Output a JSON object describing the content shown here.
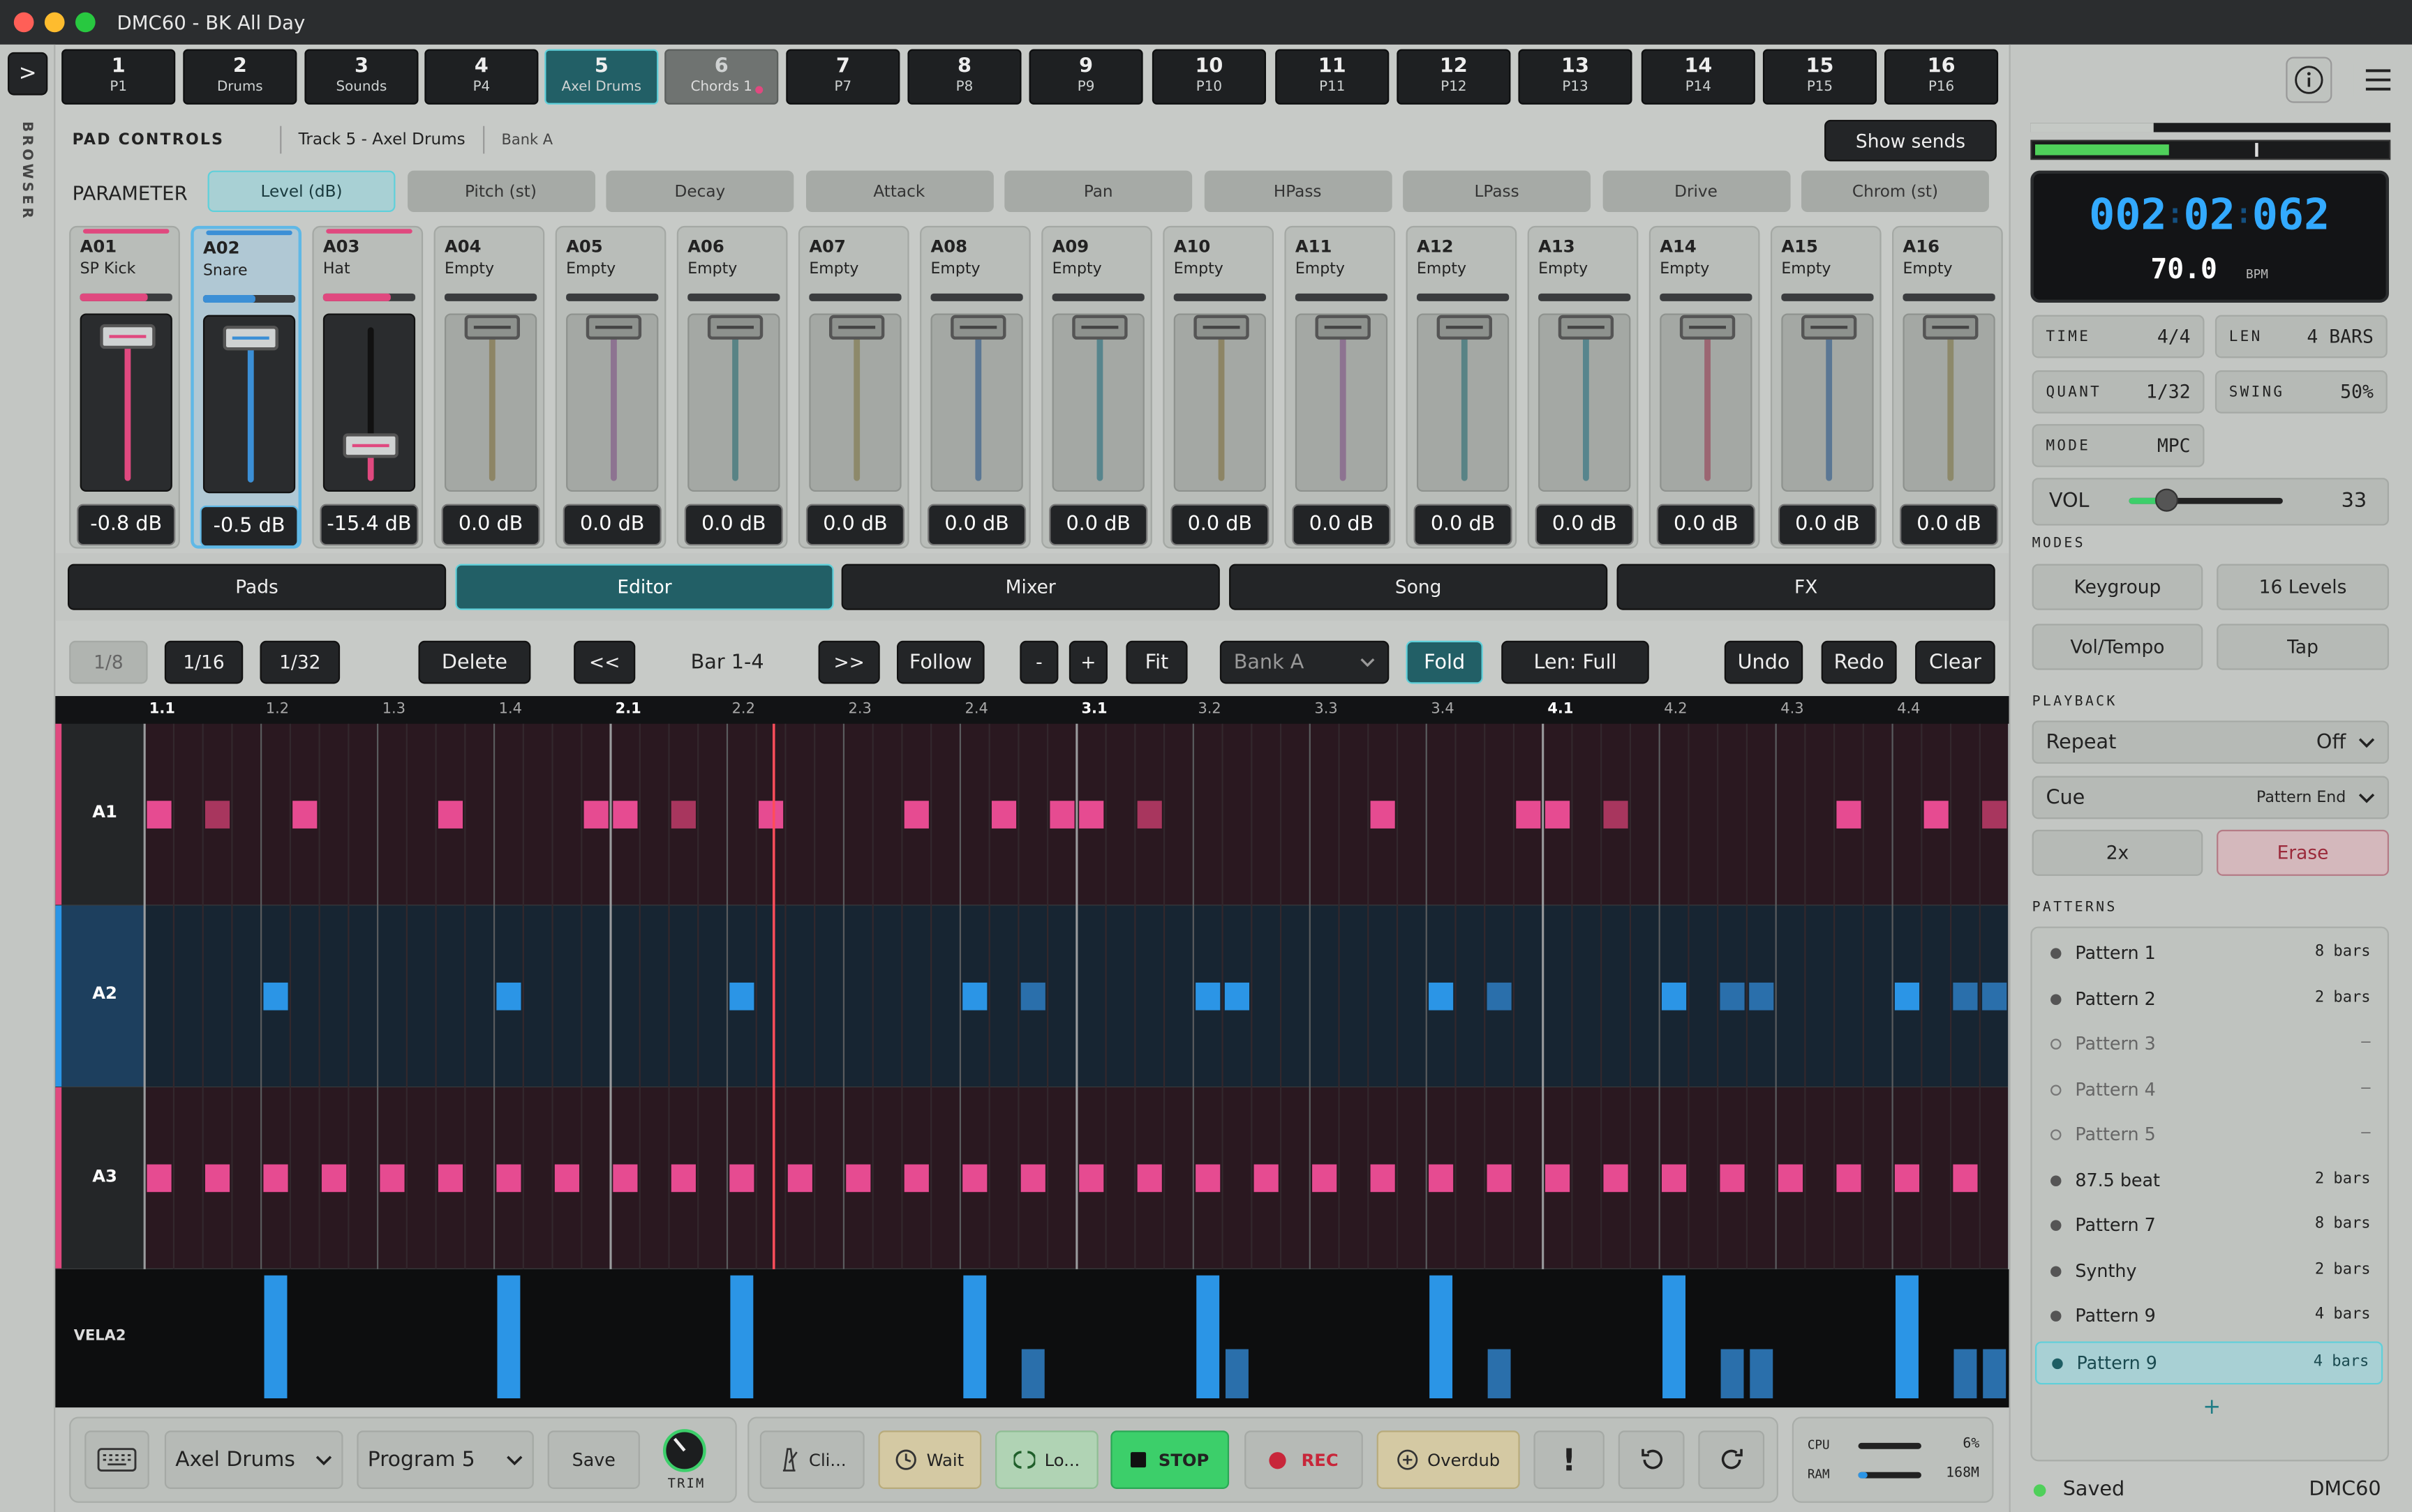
{
  "window": {
    "title": "DMC60 - BK All Day"
  },
  "sidebar": {
    "label": "BROWSER",
    "toggle": ">"
  },
  "tracks": [
    {
      "num": "1",
      "sub": "P1"
    },
    {
      "num": "2",
      "sub": "Drums"
    },
    {
      "num": "3",
      "sub": "Sounds"
    },
    {
      "num": "4",
      "sub": "P4"
    },
    {
      "num": "5",
      "sub": "Axel Drums"
    },
    {
      "num": "6",
      "sub": "Chords 1"
    },
    {
      "num": "7",
      "sub": "P7"
    },
    {
      "num": "8",
      "sub": "P8"
    },
    {
      "num": "9",
      "sub": "P9"
    },
    {
      "num": "10",
      "sub": "P10"
    },
    {
      "num": "11",
      "sub": "P11"
    },
    {
      "num": "12",
      "sub": "P12"
    },
    {
      "num": "13",
      "sub": "P13"
    },
    {
      "num": "14",
      "sub": "P14"
    },
    {
      "num": "15",
      "sub": "P15"
    },
    {
      "num": "16",
      "sub": "P16"
    }
  ],
  "pad_controls": {
    "title": "PAD CONTROLS",
    "track": "Track 5 - Axel Drums",
    "bank": "Bank A",
    "show_sends": "Show sends",
    "parameter_label": "PARAMETER",
    "params": [
      "Level (dB)",
      "Pitch (st)",
      "Decay",
      "Attack",
      "Pan",
      "HPass",
      "LPass",
      "Drive",
      "Chrom (st)"
    ]
  },
  "pads": [
    {
      "id": "A01",
      "name": "SP Kick",
      "value": "-0.8 dB",
      "color": "#e0497f"
    },
    {
      "id": "A02",
      "name": "Snare",
      "value": "-0.5 dB",
      "color": "#3b8fd6"
    },
    {
      "id": "A03",
      "name": "Hat",
      "value": "-15.4 dB",
      "color": "#e0497f"
    },
    {
      "id": "A04",
      "name": "Empty",
      "value": "0.0 dB",
      "color": "#8a7f5a"
    },
    {
      "id": "A05",
      "name": "Empty",
      "value": "0.0 dB",
      "color": "#8a6a8e"
    },
    {
      "id": "A06",
      "name": "Empty",
      "value": "0.0 dB",
      "color": "#4b7d80"
    },
    {
      "id": "A07",
      "name": "Empty",
      "value": "0.0 dB",
      "color": "#8a8460"
    },
    {
      "id": "A08",
      "name": "Empty",
      "value": "0.0 dB",
      "color": "#4f6e92"
    },
    {
      "id": "A09",
      "name": "Empty",
      "value": "0.0 dB",
      "color": "#4a7f8a"
    },
    {
      "id": "A10",
      "name": "Empty",
      "value": "0.0 dB",
      "color": "#8a7f5a"
    },
    {
      "id": "A11",
      "name": "Empty",
      "value": "0.0 dB",
      "color": "#8a6a8e"
    },
    {
      "id": "A12",
      "name": "Empty",
      "value": "0.0 dB",
      "color": "#4b7d80"
    },
    {
      "id": "A13",
      "name": "Empty",
      "value": "0.0 dB",
      "color": "#4a7f8a"
    },
    {
      "id": "A14",
      "name": "Empty",
      "value": "0.0 dB",
      "color": "#9a5a6a"
    },
    {
      "id": "A15",
      "name": "Empty",
      "value": "0.0 dB",
      "color": "#4f6e92"
    },
    {
      "id": "A16",
      "name": "Empty",
      "value": "0.0 dB",
      "color": "#8a8460"
    }
  ],
  "view_tabs": [
    "Pads",
    "Editor",
    "Mixer",
    "Song",
    "FX"
  ],
  "editor_toolbar": {
    "grid_options": [
      "1/8",
      "1/16",
      "1/32"
    ],
    "delete": "Delete",
    "prev": "<<",
    "bar_range": "Bar 1-4",
    "next": ">>",
    "follow": "Follow",
    "minus": "-",
    "plus": "+",
    "fit": "Fit",
    "bank_select": "Bank A",
    "fold": "Fold",
    "length": "Len: Full",
    "undo": "Undo",
    "redo": "Redo",
    "clear": "Clear"
  },
  "ruler": [
    "1.1",
    "1.2",
    "1.3",
    "1.4",
    "2.1",
    "2.2",
    "2.3",
    "2.4",
    "3.1",
    "3.2",
    "3.3",
    "3.4",
    "4.1",
    "4.2",
    "4.3",
    "4.4"
  ],
  "lanes": [
    {
      "label": "A1",
      "color": "#e0497f",
      "steps": [
        0,
        2,
        5,
        10,
        15,
        16,
        18,
        21,
        26,
        29,
        31,
        32,
        34,
        42,
        47,
        48,
        50,
        58,
        61,
        63
      ]
    },
    {
      "label": "A2",
      "color": "#2b95e6",
      "steps": [
        4,
        12,
        20,
        28,
        30,
        36,
        37,
        44,
        46,
        52,
        54,
        55,
        60,
        62,
        63
      ]
    },
    {
      "label": "A3",
      "color": "#e0497f",
      "steps": [
        0,
        2,
        4,
        6,
        8,
        10,
        12,
        14,
        16,
        18,
        20,
        22,
        24,
        26,
        28,
        30,
        32,
        34,
        36,
        38,
        40,
        42,
        44,
        46,
        48,
        50,
        52,
        54,
        56,
        58,
        60,
        62
      ]
    }
  ],
  "velocity": {
    "label": "VELA2",
    "values": [
      {
        "step": 4,
        "v": 100
      },
      {
        "step": 12,
        "v": 100
      },
      {
        "step": 20,
        "v": 100
      },
      {
        "step": 28,
        "v": 100
      },
      {
        "step": 30,
        "v": 40
      },
      {
        "step": 36,
        "v": 100
      },
      {
        "step": 37,
        "v": 40
      },
      {
        "step": 44,
        "v": 100
      },
      {
        "step": 46,
        "v": 40
      },
      {
        "step": 52,
        "v": 100
      },
      {
        "step": 54,
        "v": 40
      },
      {
        "step": 55,
        "v": 40
      },
      {
        "step": 60,
        "v": 100
      },
      {
        "step": 62,
        "v": 40
      },
      {
        "step": 63,
        "v": 40
      }
    ]
  },
  "playhead_step": 21.6,
  "bottom": {
    "instrument": "Axel Drums",
    "program": "Program 5",
    "save": "Save",
    "trim_label": "TRIM",
    "click": "Cli...",
    "wait": "Wait",
    "loop": "Lo...",
    "stop": "STOP",
    "rec": "REC",
    "overdub": "Overdub",
    "alert": "!",
    "cpu_label": "CPU",
    "cpu_value": "6%",
    "ram_label": "RAM",
    "ram_value": "168M"
  },
  "right": {
    "position": {
      "bars": "002",
      "beats": "02",
      "ticks": "062"
    },
    "tempo": "70.0",
    "tempo_unit": "BPM",
    "time_label": "TIME",
    "time_value": "4/4",
    "len_label": "LEN",
    "len_value": "4 BARS",
    "quant_label": "QUANT",
    "quant_value": "1/32",
    "swing_label": "SWING",
    "swing_value": "50%",
    "mode_label": "MODE",
    "mode_value": "MPC",
    "vol_label": "VOL",
    "vol_value": "33",
    "vol_level": 0.24,
    "modes_label": "MODES",
    "modes": [
      "Keygroup",
      "16 Levels",
      "Vol/Tempo",
      "Tap"
    ],
    "playback_label": "PLAYBACK",
    "repeat_label": "Repeat",
    "repeat_value": "Off",
    "cue_label": "Cue",
    "cue_value": "Pattern End",
    "double": "2x",
    "erase": "Erase",
    "patterns_label": "PATTERNS",
    "patterns": [
      {
        "name": "Pattern 1",
        "bars": "8 bars",
        "filled": true
      },
      {
        "name": "Pattern 2",
        "bars": "2 bars",
        "filled": true
      },
      {
        "name": "Pattern 3",
        "bars": "–",
        "filled": false
      },
      {
        "name": "Pattern 4",
        "bars": "–",
        "filled": false
      },
      {
        "name": "Pattern 5",
        "bars": "–",
        "filled": false
      },
      {
        "name": "87.5 beat",
        "bars": "2 bars",
        "filled": true
      },
      {
        "name": "Pattern 7",
        "bars": "8 bars",
        "filled": true
      },
      {
        "name": "Synthy",
        "bars": "2 bars",
        "filled": true
      },
      {
        "name": "Pattern 9",
        "bars": "4 bars",
        "filled": true
      },
      {
        "name": "Pattern 9",
        "bars": "4 bars",
        "filled": true,
        "selected": true
      }
    ],
    "add": "+",
    "status": "Saved",
    "app_name": "DMC60"
  },
  "colors": {
    "accent": "#5fd0da",
    "pink": "#e0497f",
    "blue": "#2b95e6",
    "lcd": "#33aaff",
    "stop": "#3ccf6a",
    "rec": "#c8263a"
  }
}
